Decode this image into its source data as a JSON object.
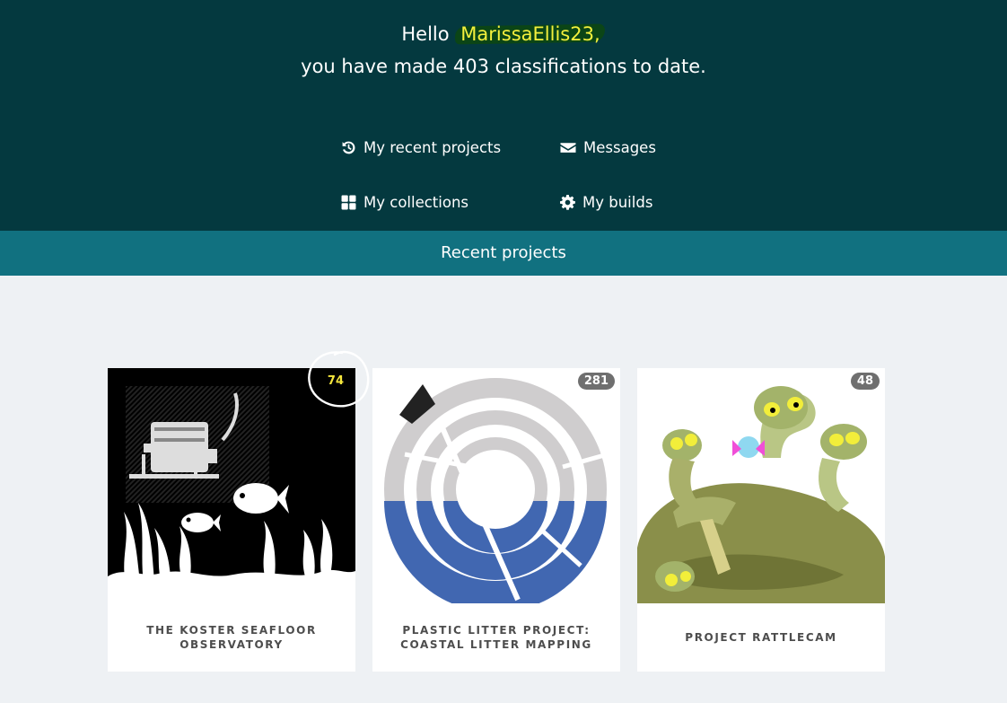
{
  "greeting": {
    "hello": "Hello",
    "username": "MarissaEllis23,",
    "summary": "you have made 403 classifications to date."
  },
  "nav": {
    "recent_projects": "My recent projects",
    "messages": "Messages",
    "collections": "My collections",
    "builds": "My builds"
  },
  "section_bar": {
    "title": "Recent projects"
  },
  "projects": [
    {
      "title": "THE KOSTER SEAFLOOR OBSERVATORY",
      "count": "74"
    },
    {
      "title": "PLASTIC LITTER PROJECT: COASTAL LITTER MAPPING",
      "count": "281"
    },
    {
      "title": "PROJECT RATTLECAM",
      "count": "48"
    }
  ],
  "icons": {
    "recent": "history-icon",
    "messages": "envelope-icon",
    "collections": "grid-icon",
    "builds": "gear-icon"
  },
  "colors": {
    "hero_bg": "#04393f",
    "bar_bg": "#117180",
    "highlight_text": "#f4f03d",
    "page_bg": "#eef1f4"
  }
}
